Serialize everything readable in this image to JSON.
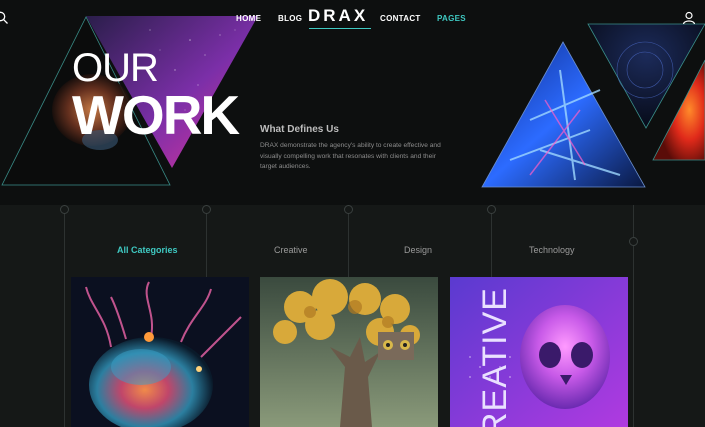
{
  "nav": {
    "items": [
      {
        "label": "HOME",
        "active": false
      },
      {
        "label": "BLOG",
        "active": false
      },
      {
        "label": "CONTACT",
        "active": false
      },
      {
        "label": "PAGES",
        "active": true
      }
    ],
    "logo": "DRAX"
  },
  "hero": {
    "title_line1": "OUR",
    "title_line2": "WORK",
    "subheading": "What Defines Us",
    "description": "DRAX demonstrate the agency's ability to create effective and visually compelling work that resonates with clients and their target audiences."
  },
  "categories": {
    "tabs": [
      {
        "label": "All Categories",
        "active": true
      },
      {
        "label": "Creative",
        "active": false
      },
      {
        "label": "Design",
        "active": false
      },
      {
        "label": "Technology",
        "active": false
      }
    ]
  },
  "portfolio": {
    "card3_overlay_text": "REATIVE"
  },
  "colors": {
    "accent": "#3fc9c2",
    "background": "#151817",
    "hero_background": "#0d0f0f"
  }
}
